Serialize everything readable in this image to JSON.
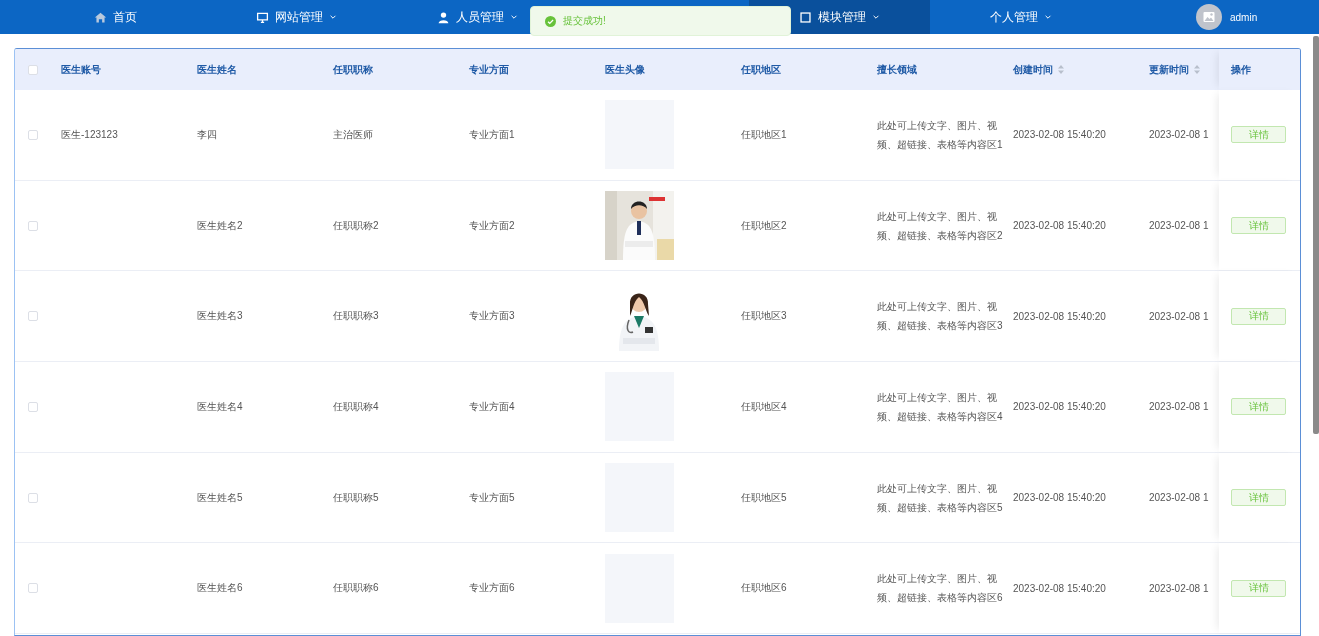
{
  "nav": {
    "items": [
      {
        "label": "首页",
        "dropdown": false,
        "selected": false
      },
      {
        "label": "网站管理",
        "dropdown": true,
        "selected": false
      },
      {
        "label": "人员管理",
        "dropdown": true,
        "selected": false
      },
      {
        "label": "模块管理",
        "dropdown": true,
        "selected": true
      },
      {
        "label": "个人管理",
        "dropdown": true,
        "selected": false
      }
    ],
    "user": {
      "name": "admin"
    }
  },
  "toast": {
    "message": "提交成功!"
  },
  "table": {
    "select_all": {
      "checked": false
    },
    "columns": [
      {
        "label": "医生账号",
        "sortable": false
      },
      {
        "label": "医生姓名",
        "sortable": false
      },
      {
        "label": "任职职称",
        "sortable": false
      },
      {
        "label": "专业方面",
        "sortable": false
      },
      {
        "label": "医生头像",
        "sortable": false
      },
      {
        "label": "任职地区",
        "sortable": false
      },
      {
        "label": "擅长领域",
        "sortable": false
      },
      {
        "label": "创建时间",
        "sortable": true
      },
      {
        "label": "更新时间",
        "sortable": true
      },
      {
        "label": "操作",
        "sortable": false
      }
    ],
    "rows": [
      {
        "checked": false,
        "account": "医生-123123",
        "name": "李四",
        "title": "主治医师",
        "direction": "专业方面1",
        "avatar": {
          "kind": "empty"
        },
        "region": "任职地区1",
        "field": "此处可上传文字、图片、视频、超链接、表格等内容区1",
        "created": "2023-02-08 15:40:20",
        "updated": "2023-02-08 1",
        "action": "详情"
      },
      {
        "checked": false,
        "name": "医生姓名2",
        "title": "任职职称2",
        "direction": "专业方面2",
        "region": "任职地区2",
        "field": "此处可上传文字、图片、视频、超链接、表格等内容区2",
        "created": "2023-02-08 15:40:20",
        "updated": "2023-02-08 1",
        "action": "详情"
      },
      {
        "checked": false,
        "name": "医生姓名3",
        "title": "任职职称3",
        "direction": "专业方面3",
        "region": "任职地区3",
        "field": "此处可上传文字、图片、视频、超链接、表格等内容区3",
        "created": "2023-02-08 15:40:20",
        "updated": "2023-02-08 1",
        "action": "详情"
      },
      {
        "checked": false,
        "name": "医生姓名4",
        "title": "任职职称4",
        "direction": "专业方面4",
        "avatar": {
          "kind": "empty"
        },
        "region": "任职地区4",
        "field": "此处可上传文字、图片、视频、超链接、表格等内容区4",
        "created": "2023-02-08 15:40:20",
        "updated": "2023-02-08 1",
        "action": "详情"
      },
      {
        "checked": false,
        "name": "医生姓名5",
        "title": "任职职称5",
        "direction": "专业方面5",
        "avatar": {
          "kind": "empty"
        },
        "region": "任职地区5",
        "field": "此处可上传文字、图片、视频、超链接、表格等内容区5",
        "created": "2023-02-08 15:40:20",
        "updated": "2023-02-08 1",
        "action": "详情"
      },
      {
        "checked": false,
        "name": "医生姓名6",
        "title": "任职职称6",
        "direction": "专业方面6",
        "avatar": {
          "kind": "empty"
        },
        "region": "任职地区6",
        "field": "此处可上传文字、图片、视频、超链接、表格等内容区6",
        "created": "2023-02-08 15:40:20",
        "updated": "2023-02-08 1",
        "action": "详情"
      }
    ]
  }
}
